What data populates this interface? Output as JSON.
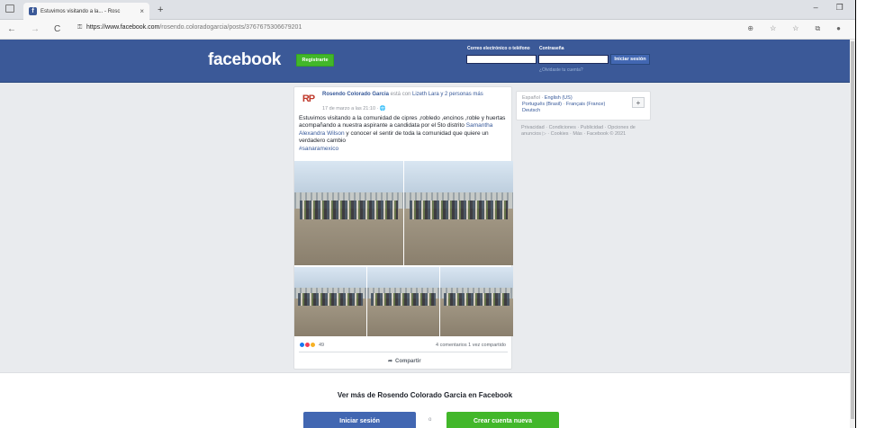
{
  "browser": {
    "tab_title": "Estuvimos visitando a la... - Rosc",
    "tab_close": "×",
    "new_tab": "+",
    "url_host": "https://www.facebook.com",
    "url_path": "/rosendo.coloradogarcia/posts/3767675306679201",
    "window_controls": [
      "–",
      "❐",
      "×"
    ],
    "nav": {
      "back": "←",
      "forward": "→",
      "refresh": "C"
    },
    "lock_icon": "🔒",
    "address_icons": [
      "zoom-icon",
      "favorite-add-icon",
      "favorites-icon",
      "collections-icon",
      "profile-icon",
      "more-icon"
    ],
    "address_glyphs": [
      "⊕",
      "☆",
      "☆",
      "⧉",
      "●",
      "⋯"
    ]
  },
  "header": {
    "logo": "facebook",
    "register_label": "Registrarte",
    "email_label": "Correo electrónico o teléfono",
    "password_label": "Contraseña",
    "forgot_label": "¿Olvidaste tu cuenta?",
    "login_label": "Iniciar sesión",
    "brand_color": "#3b5998"
  },
  "post": {
    "avatar_text": "RP",
    "author": "Rosendo Colorado Garcia",
    "with_text": " está con ",
    "tagged": "Lizeth Lara y 2 personas más",
    "time": "17 de marzo a las 21:10 · 🌐",
    "text_1": "Estuvimos visitando a la comunidad de cipres ,robledo ,encinos ,roble y huertas acompañando a nuestra aspirante a candidata por el 5to distrito",
    "text_link": "Samantha Alexandra Wilson",
    "text_2": "y conocer el sentir de toda la comunidad que quiere un verdadero cambio",
    "hashtag": "#sanaramexico",
    "reaction_count": "49",
    "comments_shares": "4 comentarios  1 vez compartido",
    "share_label": "Compartir"
  },
  "languages": {
    "current": "Español",
    "options_line1": "English (US)",
    "options_line2a": "Português (Brasil)",
    "options_line2b": "Français (France)",
    "options_line3": "Deutsch",
    "plus": "+",
    "footer": "Privacidad · Condiciones · Publicidad · Opciones de anuncios ▷ · Cookies · Más · Facebook © 2021"
  },
  "banner": {
    "title": "Ver más de Rosendo Colorado Garcia en Facebook",
    "login_label": "Iniciar sesión",
    "or": "o",
    "create_label": "Crear cuenta nueva"
  }
}
